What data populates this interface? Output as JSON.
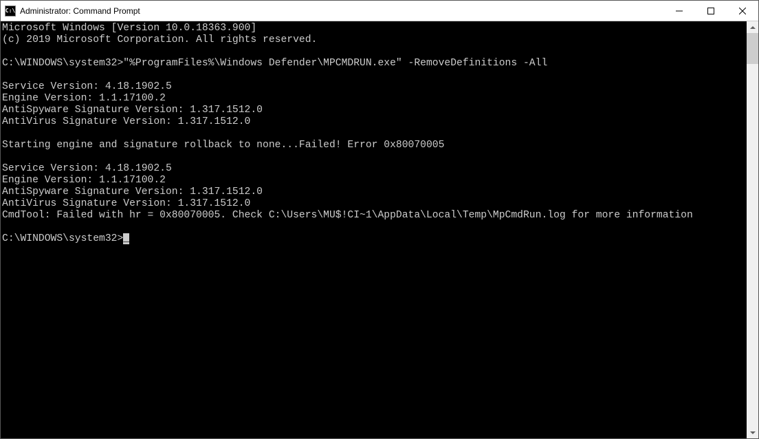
{
  "window": {
    "title": "Administrator: Command Prompt",
    "icon_label": "C:\\"
  },
  "terminal": {
    "lines": [
      "Microsoft Windows [Version 10.0.18363.900]",
      "(c) 2019 Microsoft Corporation. All rights reserved.",
      "",
      "C:\\WINDOWS\\system32>\"%ProgramFiles%\\Windows Defender\\MPCMDRUN.exe\" -RemoveDefinitions -All",
      "",
      "Service Version: 4.18.1902.5",
      "Engine Version: 1.1.17100.2",
      "AntiSpyware Signature Version: 1.317.1512.0",
      "AntiVirus Signature Version: 1.317.1512.0",
      "",
      "Starting engine and signature rollback to none...Failed! Error 0x80070005",
      "",
      "Service Version: 4.18.1902.5",
      "Engine Version: 1.1.17100.2",
      "AntiSpyware Signature Version: 1.317.1512.0",
      "AntiVirus Signature Version: 1.317.1512.0",
      "CmdTool: Failed with hr = 0x80070005. Check C:\\Users\\MU$!CI~1\\AppData\\Local\\Temp\\MpCmdRun.log for more information",
      "",
      "C:\\WINDOWS\\system32>"
    ],
    "cursor": "_"
  }
}
